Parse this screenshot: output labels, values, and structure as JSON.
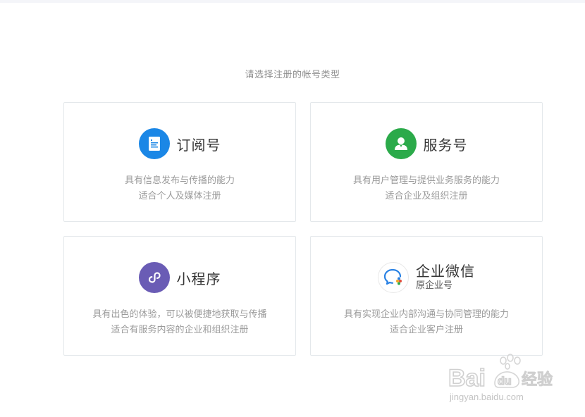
{
  "page": {
    "heading": "请选择注册的帐号类型"
  },
  "cards": [
    {
      "title": "订阅号",
      "icon": "subscription-doc-icon",
      "accent": "#1b87e6",
      "desc_line1": "具有信息发布与传播的能力",
      "desc_line2": "适合个人及媒体注册"
    },
    {
      "title": "服务号",
      "icon": "service-user-icon",
      "accent": "#2baa4a",
      "desc_line1": "具有用户管理与提供业务服务的能力",
      "desc_line2": "适合企业及组织注册"
    },
    {
      "title": "小程序",
      "icon": "mini-program-icon",
      "accent": "#6a5cb5",
      "desc_line1": "具有出色的体验，可以被便捷地获取与传播",
      "desc_line2": "适合有服务内容的企业和组织注册"
    },
    {
      "title": "企业微信",
      "subtitle": "原企业号",
      "icon": "wecom-icon",
      "accent": "#2a82e4",
      "desc_line1": "具有实现企业内部沟通与协同管理的能力",
      "desc_line2": "适合企业客户注册"
    }
  ],
  "watermark": {
    "logo": "Bai du 经验",
    "url": "jingyan.baidu.com"
  }
}
